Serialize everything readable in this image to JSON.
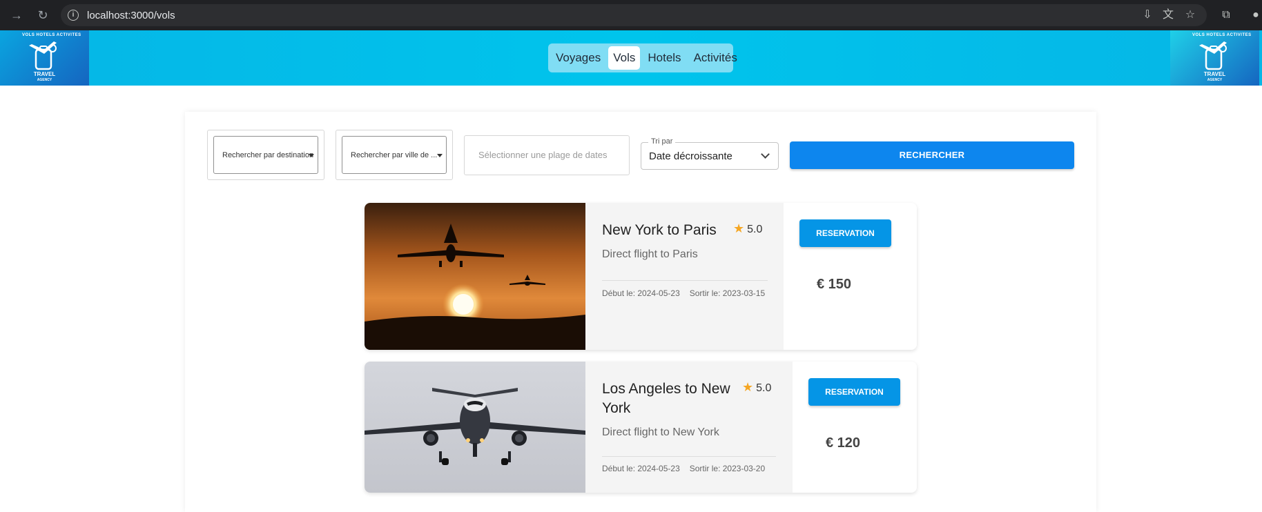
{
  "browser": {
    "url_host": "localhost",
    "url_path": ":3000/vols"
  },
  "header": {
    "logo_text": "TRAVEL",
    "logo_subtext": "AGENCY",
    "logo_arc": "VOLS HOTELS ACTIVITES",
    "tabs": [
      {
        "label": "Voyages",
        "active": false
      },
      {
        "label": "Vols",
        "active": true
      },
      {
        "label": "Hotels",
        "active": false
      },
      {
        "label": "Activités",
        "active": false
      }
    ]
  },
  "filters": {
    "destination_placeholder": "Rechercher par destination",
    "city_placeholder": "Rechercher par ville de ...",
    "date_placeholder": "Sélectionner une plage de dates",
    "sort_label": "Tri par",
    "sort_value": "Date décroissante",
    "search_label": "RECHERCHER"
  },
  "flights": [
    {
      "title": "New York to Paris",
      "rating": "5.0",
      "description": "Direct flight to Paris",
      "start": "Début le: 2024-05-23",
      "end": "Sortir le: 2023-03-15",
      "reservation_label": "RESERVATION",
      "price": "€ 150"
    },
    {
      "title": "Los Angeles to New York",
      "rating": "5.0",
      "description": "Direct flight to New York",
      "start": "Début le: 2024-05-23",
      "end": "Sortir le: 2023-03-20",
      "reservation_label": "RESERVATION",
      "price": "€ 120"
    }
  ]
}
